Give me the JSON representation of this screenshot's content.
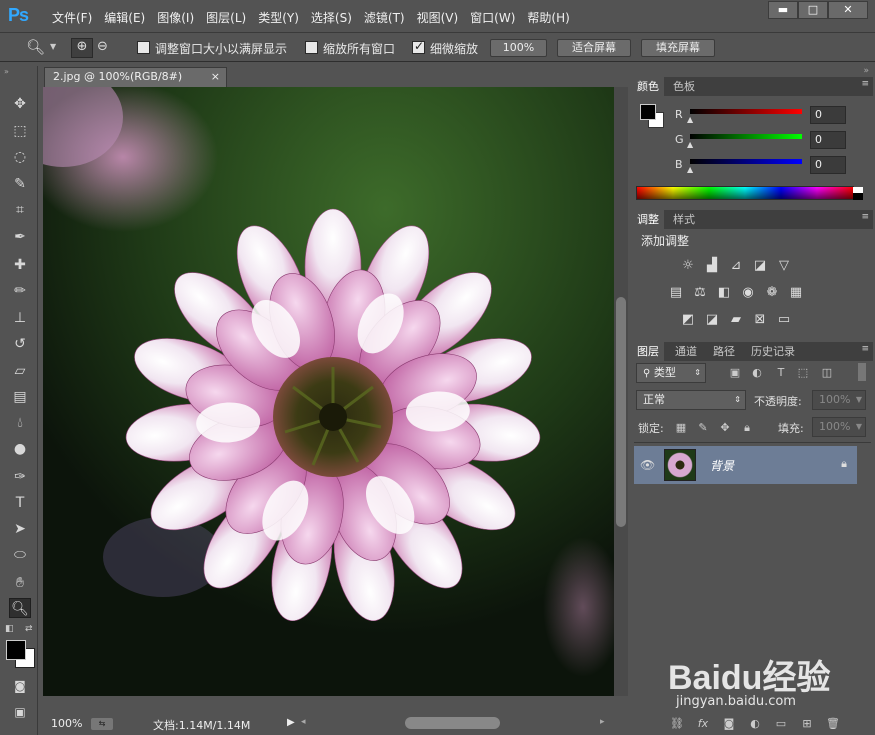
{
  "app": {
    "logo": "Ps"
  },
  "menu": [
    "文件(F)",
    "编辑(E)",
    "图像(I)",
    "图层(L)",
    "类型(Y)",
    "选择(S)",
    "滤镜(T)",
    "视图(V)",
    "窗口(W)",
    "帮助(H)"
  ],
  "window_controls": {
    "minimize": "▬",
    "maximize": "□",
    "close": "✕"
  },
  "options": {
    "resize_windows": "调整窗口大小以满屏显示",
    "zoom_all": "缩放所有窗口",
    "scrubby_zoom": "细微缩放",
    "scrubby_checked": true,
    "btn_100": "100%",
    "btn_fit": "适合屏幕",
    "btn_fill": "填充屏幕"
  },
  "document": {
    "tab_title": "2.jpg @ 100%(RGB/8#)",
    "tab_close": "×"
  },
  "status": {
    "zoom": "100%",
    "doc_info": "文档:1.14M/1.14M"
  },
  "color_panel": {
    "tabs": [
      "颜色",
      "色板"
    ],
    "channels": [
      {
        "label": "R",
        "value": "0",
        "color": "#e0302a"
      },
      {
        "label": "G",
        "value": "0",
        "color": "#2ad02a"
      },
      {
        "label": "B",
        "value": "0",
        "color": "#3045e0"
      }
    ]
  },
  "adjust_panel": {
    "tabs": [
      "调整",
      "样式"
    ],
    "title": "添加调整"
  },
  "layers_panel": {
    "tabs": [
      "图层",
      "通道",
      "路径",
      "历史记录"
    ],
    "filter_kind": "类型",
    "blend_mode": "正常",
    "opacity_label": "不透明度:",
    "opacity_value": "100%",
    "lock_label": "锁定:",
    "fill_label": "填充:",
    "fill_value": "100%",
    "layer_name": "背景"
  },
  "watermark": {
    "brand": "Baidu经验",
    "url": "jingyan.baidu.com"
  },
  "colors": {
    "ps_blue": "#31a8ff",
    "panel_bg": "#535353",
    "layer_selected": "#6d7d96"
  }
}
